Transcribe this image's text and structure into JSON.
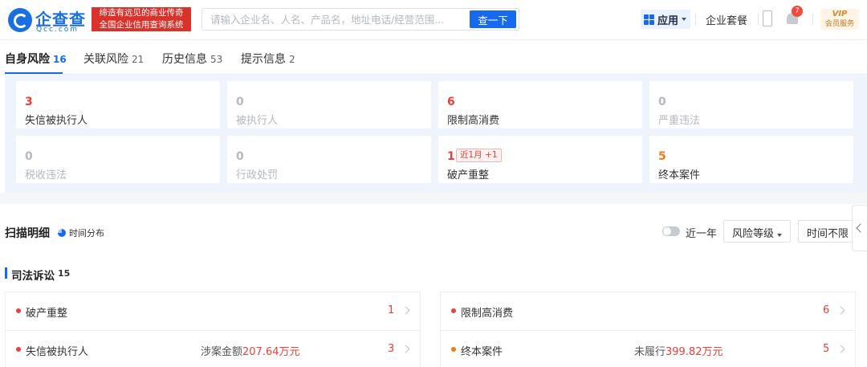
{
  "header": {
    "logo_cn": "企查查",
    "logo_en": "Qcc.com",
    "slogan_line1": "缔造有远见的商业传奇",
    "slogan_line2": "全国企业信用查询系统",
    "search_placeholder": "请输入企业名、人名、产品名，地址电话/经营范围...",
    "search_button": "查一下",
    "apps_label": "应用",
    "package_label": "企业套餐",
    "notification_count": "7",
    "vip_top": "VIP",
    "vip_bottom": "会员服务"
  },
  "tabs": [
    {
      "label": "自身风险",
      "count": "16"
    },
    {
      "label": "关联风险",
      "count": "21"
    },
    {
      "label": "历史信息",
      "count": "53"
    },
    {
      "label": "提示信息",
      "count": "2"
    }
  ],
  "risk_cards": [
    {
      "value": "3",
      "label": "失信被执行人"
    },
    {
      "value": "0",
      "label": "被执行人"
    },
    {
      "value": "6",
      "label": "限制高消费"
    },
    {
      "value": "0",
      "label": "严重违法"
    },
    {
      "value": "0",
      "label": "税收违法"
    },
    {
      "value": "0",
      "label": "行政处罚"
    },
    {
      "value": "1",
      "label": "破产重整",
      "badge": "近1月 +1"
    },
    {
      "value": "5",
      "label": "终本案件"
    }
  ],
  "scan": {
    "title": "扫描明细",
    "timeline_label": "时间分布",
    "toggle_label": "近一年",
    "filter_risk": "风险等级",
    "filter_time": "时间不限"
  },
  "section": {
    "title": "司法诉讼",
    "count": "15"
  },
  "list_left": [
    {
      "label": "破产重整",
      "extra_prefix": "",
      "extra_amount": "",
      "count": "1"
    },
    {
      "label": "失信被执行人",
      "extra_prefix": "涉案金额",
      "extra_amount": "207.64万元",
      "count": "3"
    }
  ],
  "list_right": [
    {
      "label": "限制高消费",
      "extra_prefix": "",
      "extra_amount": "",
      "count": "6"
    },
    {
      "label": "终本案件",
      "extra_prefix": "未履行",
      "extra_amount": "399.82万元",
      "count": "5"
    }
  ],
  "colors": {
    "brand_blue": "#1769f0",
    "risk_red": "#e8413a",
    "risk_orange": "#f07b17"
  }
}
